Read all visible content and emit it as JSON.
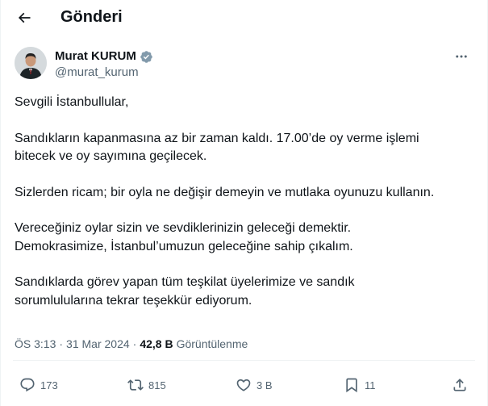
{
  "header": {
    "title": "Gönderi",
    "back_icon": "arrow-left-icon"
  },
  "author": {
    "display_name": "Murat KURUM",
    "handle": "@murat_kurum",
    "verified_icon": "verified-badge-icon",
    "verified_color": "#829aab"
  },
  "post": {
    "paragraphs": [
      [
        "Sevgili İstanbullular,"
      ],
      [
        "Sandıkların kapanmasına az bir zaman kaldı. 17.00’de oy verme işlemi",
        "bitecek ve oy sayımına geçilecek."
      ],
      [
        "Sizlerden ricam; bir oyla ne değişir demeyin ve mutlaka oyunuzu kullanın."
      ],
      [
        "Vereceğiniz oylar sizin ve sevdiklerinizin geleceği demektir.",
        "Demokrasimize, İstanbul’umuzun geleceğine sahip çıkalım."
      ],
      [
        "Sandıklarda görev yapan tüm teşkilat üyelerimize ve sandık",
        "sorumlulularına tekrar teşekkür ediyorum."
      ]
    ],
    "time": "ÖS 3:13",
    "separator": "·",
    "date": "31 Mar 2024",
    "views_count": "42,8 B",
    "views_label": "Görüntülenme"
  },
  "actions": {
    "replies": "173",
    "reposts": "815",
    "likes": "3 B",
    "bookmarks": "11"
  },
  "colors": {
    "text": "#0f1419",
    "muted": "#536471",
    "border": "#eff3f4"
  }
}
